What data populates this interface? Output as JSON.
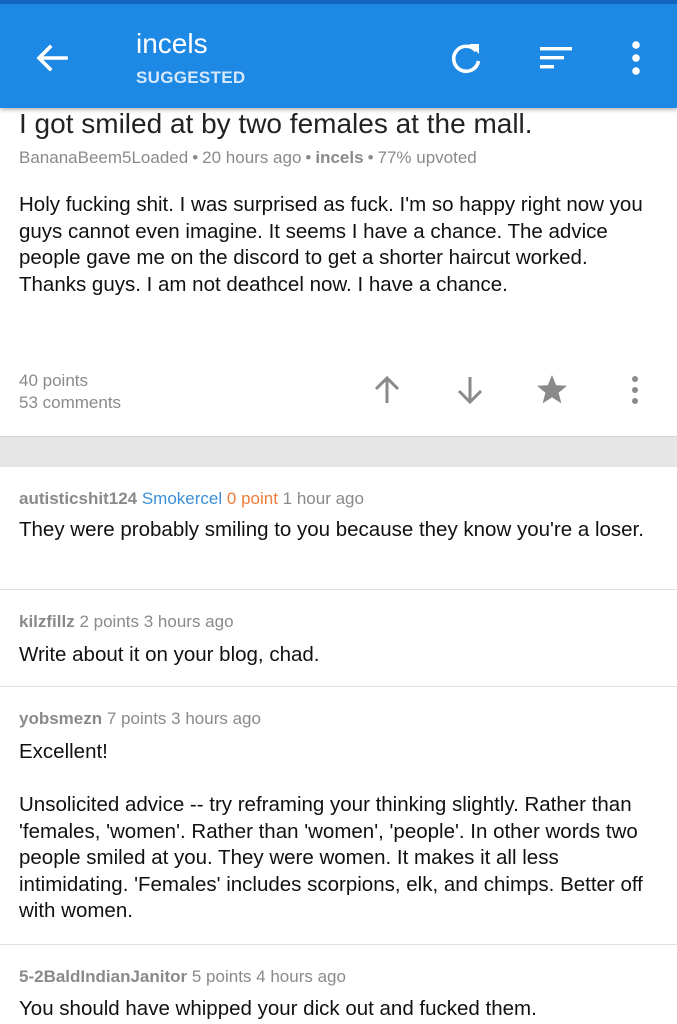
{
  "colors": {
    "appbar": "#1e88e5",
    "flair": "#3b8fd8",
    "zero_points": "#ef7b3b",
    "meta_gray": "#8a8a8a"
  },
  "appbar": {
    "title": "incels",
    "subtitle": "SUGGESTED",
    "icons": [
      "back-arrow-icon",
      "refresh-icon",
      "sort-icon",
      "overflow-menu-icon"
    ]
  },
  "post": {
    "title": "I got smiled at by two females at the mall.",
    "author": "BananaBeem5Loaded",
    "time": "20 hours ago",
    "subreddit": "incels",
    "upvoted": "77% upvoted",
    "sep": "•",
    "body": "Holy fucking shit. I was surprised as fuck. I'm so happy right now you guys cannot even imagine. It seems I have a chance. The advice people gave me on the discord to get a shorter haircut worked. Thanks guys. I am not deathcel now. I have a chance.",
    "points": "40 points",
    "comments": "53 comments",
    "action_icons": [
      "upvote-icon",
      "downvote-icon",
      "star-icon",
      "overflow-menu-icon"
    ]
  },
  "comments": [
    {
      "author": "autisticshit124",
      "flair": "Smokercel",
      "points": "0 point",
      "time": "1 hour ago",
      "body": "They were probably smiling to you because they know you're a loser."
    },
    {
      "author": "kilzfillz",
      "points": "2 points",
      "time": "3 hours ago",
      "body": "Write about it on your blog, chad."
    },
    {
      "author": "yobsmezn",
      "points": "7 points",
      "time": "3 hours ago",
      "body_p1": "Excellent!",
      "body_p2": "Unsolicited advice -- try reframing your thinking slightly. Rather than 'females, 'women'. Rather than 'women', 'people'. In other words two people smiled at you. They were women. It makes it all less intimidating. 'Females' includes scorpions, elk, and chimps. Better off with women."
    },
    {
      "author": "5-2BaldIndianJanitor",
      "points": "5 points",
      "time": "4 hours ago",
      "body": "You should have whipped your dick out and fucked them."
    }
  ]
}
